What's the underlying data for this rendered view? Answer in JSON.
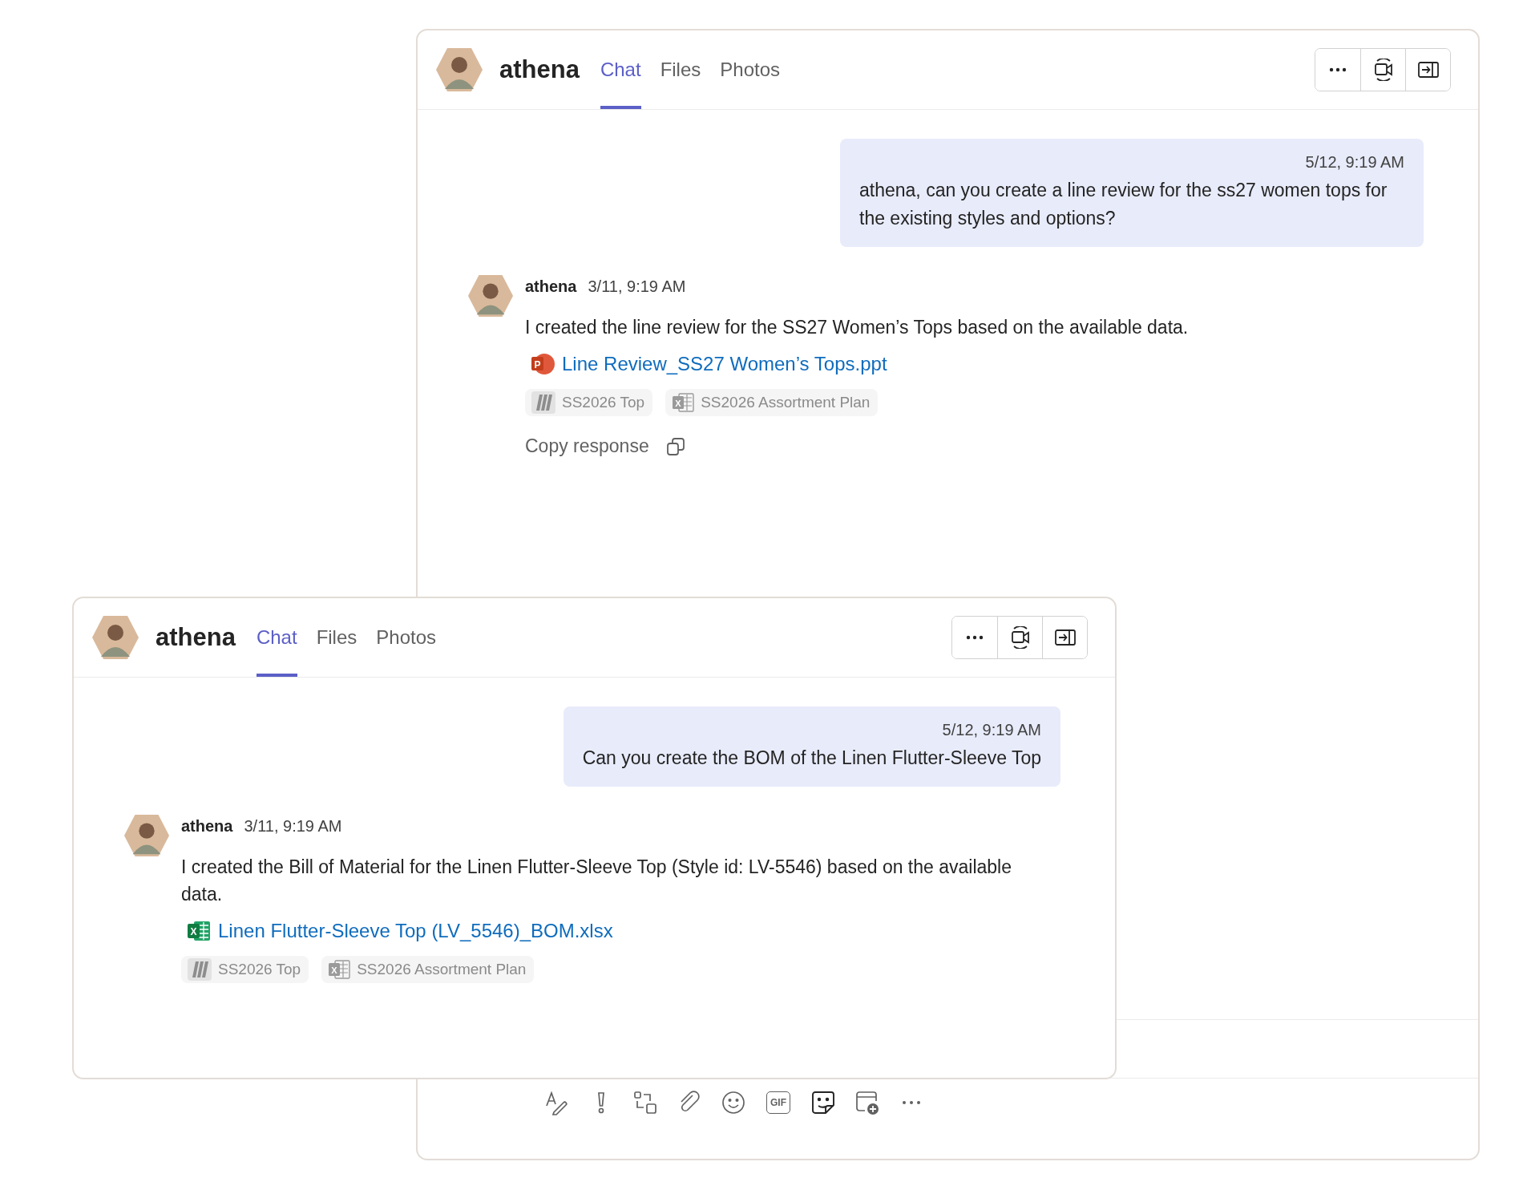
{
  "windows": [
    {
      "contact": "athena",
      "tabs": [
        {
          "label": "Chat",
          "selected": true
        },
        {
          "label": "Files",
          "selected": false
        },
        {
          "label": "Photos",
          "selected": false
        }
      ],
      "messages": [
        {
          "kind": "sent",
          "time": "5/12, 9:19 AM",
          "text": "athena, can you create a line review for the ss27 women tops for the existing styles and options?"
        },
        {
          "kind": "received",
          "sender": "athena",
          "time": "3/11, 9:19 AM",
          "text": "I created the line review for the SS27 Women’s Tops based on the available data.",
          "attachment": {
            "kind": "powerpoint",
            "icon_letter": "P",
            "name": "Line Review_SS27 Women’s Tops.ppt"
          },
          "sources": [
            {
              "kind": "board",
              "label": "SS2026 Top"
            },
            {
              "kind": "spreadsheet",
              "icon_letter": "X",
              "label": "SS2026 Assortment Plan"
            }
          ],
          "copy_label": "Copy response"
        }
      ],
      "composer": {
        "tools": [
          {
            "kind": "format"
          },
          {
            "kind": "important"
          },
          {
            "kind": "loop"
          },
          {
            "kind": "attach"
          },
          {
            "kind": "emoji"
          },
          {
            "kind": "gif",
            "label": "GIF"
          },
          {
            "kind": "sticker"
          },
          {
            "kind": "schedule"
          },
          {
            "kind": "more"
          }
        ]
      }
    },
    {
      "contact": "athena",
      "tabs": [
        {
          "label": "Chat",
          "selected": true
        },
        {
          "label": "Files",
          "selected": false
        },
        {
          "label": "Photos",
          "selected": false
        }
      ],
      "messages": [
        {
          "kind": "sent",
          "time": "5/12, 9:19 AM",
          "text": "Can you create the BOM of the Linen Flutter-Sleeve Top"
        },
        {
          "kind": "received",
          "sender": "athena",
          "time": "3/11, 9:19 AM",
          "text": "I created the Bill of Material for the Linen Flutter-Sleeve Top (Style id: LV-5546) based on the available data.",
          "attachment": {
            "kind": "excel",
            "icon_letter": "X",
            "name": "Linen Flutter-Sleeve Top (LV_5546)_BOM.xlsx"
          },
          "sources": [
            {
              "kind": "board",
              "label": "SS2026 Top"
            },
            {
              "kind": "spreadsheet",
              "icon_letter": "X",
              "label": "SS2026 Assortment Plan"
            }
          ]
        }
      ]
    }
  ]
}
